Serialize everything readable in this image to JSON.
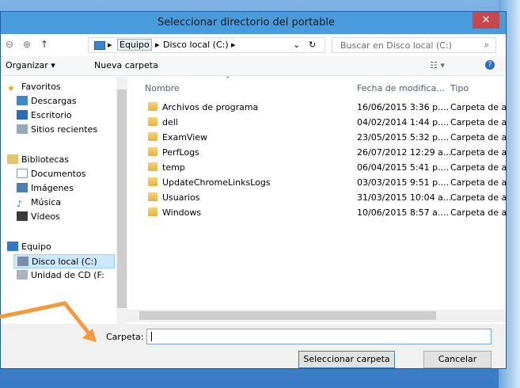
{
  "window": {
    "title": "Seleccionar directorio del portable",
    "close_label": "✕"
  },
  "address": {
    "crumbs": [
      "Equipo",
      "Disco local (C:)"
    ],
    "search_placeholder": "Buscar en Disco local (C:)"
  },
  "toolbar": {
    "organize": "Organizar ▾",
    "new_folder": "Nueva carpeta"
  },
  "nav": {
    "favorites": "Favoritos",
    "downloads": "Descargas",
    "desktop": "Escritorio",
    "recent": "Sitios recientes",
    "libraries": "Bibliotecas",
    "documents": "Documentos",
    "images": "Imágenes",
    "music": "Música",
    "videos": "Vídeos",
    "computer": "Equipo",
    "local_disk": "Disco local (C:)",
    "cd_drive": "Unidad de CD (F:"
  },
  "columns": {
    "name": "Nombre",
    "date": "Fecha de modifica...",
    "type": "Tipo"
  },
  "rows": [
    {
      "name": "Archivos de programa",
      "date": "16/06/2015 3:36 p....",
      "type": "Carpeta de a"
    },
    {
      "name": "dell",
      "date": "04/02/2014 1:44 p....",
      "type": "Carpeta de a"
    },
    {
      "name": "ExamView",
      "date": "23/05/2015 5:32 p....",
      "type": "Carpeta de a"
    },
    {
      "name": "PerfLogs",
      "date": "26/07/2012 12:29 a...",
      "type": "Carpeta de a"
    },
    {
      "name": "temp",
      "date": "06/04/2015 5:41 p....",
      "type": "Carpeta de a"
    },
    {
      "name": "UpdateChromeLinksLogs",
      "date": "03/03/2015 9:51 p....",
      "type": "Carpeta de a"
    },
    {
      "name": "Usuarios",
      "date": "31/03/2015 10:04 a...",
      "type": "Carpeta de a"
    },
    {
      "name": "Windows",
      "date": "10/06/2015 8:57 a....",
      "type": "Carpeta de a"
    }
  ],
  "folder_field": {
    "label": "Carpeta:",
    "value": ""
  },
  "buttons": {
    "select": "Seleccionar carpeta",
    "cancel": "Cancelar"
  },
  "colors": {
    "accent": "#4a9bdb",
    "arrow": "#f39a3c",
    "close": "#c7474b"
  }
}
